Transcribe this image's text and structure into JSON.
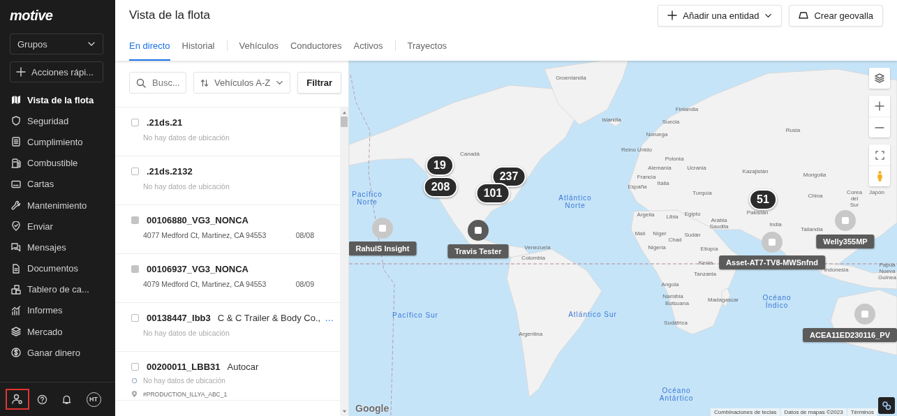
{
  "sidebar": {
    "logo": "motive",
    "groups_dropdown": "Grupos",
    "quick_actions": "Acciones rápi...",
    "nav": [
      {
        "label": "Vista de la flota",
        "selected": true
      },
      {
        "label": "Seguridad",
        "selected": false
      },
      {
        "label": "Cumplimiento",
        "selected": false
      },
      {
        "label": "Combustible",
        "selected": false
      },
      {
        "label": "Cartas",
        "selected": false
      },
      {
        "label": "Mantenimiento",
        "selected": false
      },
      {
        "label": "Enviar",
        "selected": false
      },
      {
        "label": "Mensajes",
        "selected": false
      },
      {
        "label": "Documentos",
        "selected": false
      },
      {
        "label": "Tablero de ca...",
        "selected": false
      },
      {
        "label": "Informes",
        "selected": false
      },
      {
        "label": "Mercado",
        "selected": false
      },
      {
        "label": "Ganar dinero",
        "selected": false
      }
    ],
    "footer": [
      {
        "kind": "user-settings",
        "highlighted": true
      },
      {
        "kind": "help",
        "highlighted": false
      },
      {
        "kind": "notifications",
        "highlighted": false
      },
      {
        "kind": "avatar",
        "initials": "HT",
        "highlighted": false
      }
    ]
  },
  "header": {
    "title": "Vista de la flota",
    "buttons": [
      {
        "kind": "add",
        "label": "Añadir una entidad"
      },
      {
        "kind": "geofence",
        "label": "Crear geovalla"
      }
    ]
  },
  "tabs": [
    {
      "label": "En directo",
      "selected": true,
      "divider_before": false
    },
    {
      "label": "Historial",
      "selected": false,
      "divider_before": false
    },
    {
      "label": "Vehículos",
      "selected": false,
      "divider_before": true
    },
    {
      "label": "Conductores",
      "selected": false,
      "divider_before": false
    },
    {
      "label": "Activos",
      "selected": false,
      "divider_before": false
    },
    {
      "label": "Trayectos",
      "selected": false,
      "divider_before": true
    }
  ],
  "toolbar": {
    "search": {
      "placeholder": "Busc..."
    },
    "sort": "Vehículos A-Z",
    "filter": "Filtrar"
  },
  "vehicles": [
    {
      "kind": "plain",
      "name": ".21ds.21",
      "location": "No hay datos de ubicación",
      "disabled": false
    },
    {
      "kind": "plain",
      "name": ".21ds.2132",
      "location": "No hay datos de ubicación",
      "disabled": false
    },
    {
      "kind": "plain",
      "name": "00106880_VG3_NONCA",
      "location": "4077 Medford Ct, Martinez, CA 94553",
      "date": "08/08",
      "disabled": true
    },
    {
      "kind": "plain",
      "name": "00106937_VG3_NONCA",
      "location": "4079 Medford Ct, Martinez, CA 94553",
      "date": "08/09",
      "disabled": true
    },
    {
      "kind": "plain",
      "name": "00138447_lbb3",
      "group": "C & C Trailer & Body Co.,",
      "more": "…",
      "location": "No hay datos de ubicación",
      "disabled": false
    },
    {
      "kind": "route",
      "name": "00200011_LBB31",
      "group": "Autocar",
      "location": "No hay datos de ubicación",
      "tag": "#PRODUCTION_ILLYA_ABC_1",
      "disabled": false
    }
  ],
  "map": {
    "labels": [
      {
        "text": "Groenlandia",
        "kind": "country"
      },
      {
        "text": "Islandia",
        "kind": "country"
      },
      {
        "text": "Canadá",
        "kind": "country"
      },
      {
        "text": "Pacífico Norte",
        "kind": "ocean"
      },
      {
        "text": "Atlántico Norte",
        "kind": "ocean"
      },
      {
        "text": "Venezuela",
        "kind": "country"
      },
      {
        "text": "Colombia",
        "kind": "country"
      },
      {
        "text": "Finlandia",
        "kind": "country"
      },
      {
        "text": "Suecia",
        "kind": "country"
      },
      {
        "text": "Noruega",
        "kind": "country"
      },
      {
        "text": "Reino Unido",
        "kind": "country"
      },
      {
        "text": "Polonia",
        "kind": "country"
      },
      {
        "text": "Alemania",
        "kind": "country"
      },
      {
        "text": "Ucrania",
        "kind": "country"
      },
      {
        "text": "Francia",
        "kind": "country"
      },
      {
        "text": "Italia",
        "kind": "country"
      },
      {
        "text": "España",
        "kind": "country"
      },
      {
        "text": "Turquía",
        "kind": "country"
      },
      {
        "text": "Rusia",
        "kind": "country"
      },
      {
        "text": "Kazajistán",
        "kind": "country"
      },
      {
        "text": "Mongolia",
        "kind": "country"
      },
      {
        "text": "China",
        "kind": "country"
      },
      {
        "text": "Corea del Sur",
        "kind": "country"
      },
      {
        "text": "Japón",
        "kind": "country"
      },
      {
        "text": "Argelia",
        "kind": "country"
      },
      {
        "text": "Libia",
        "kind": "country"
      },
      {
        "text": "Egipto",
        "kind": "country"
      },
      {
        "text": "Arabia Saudita",
        "kind": "country"
      },
      {
        "text": "Pakistán",
        "kind": "country"
      },
      {
        "text": "India",
        "kind": "country"
      },
      {
        "text": "Tailandia",
        "kind": "country"
      },
      {
        "text": "Malí",
        "kind": "country"
      },
      {
        "text": "Níger",
        "kind": "country"
      },
      {
        "text": "Chad",
        "kind": "country"
      },
      {
        "text": "Sudán",
        "kind": "country"
      },
      {
        "text": "Nigeria",
        "kind": "country"
      },
      {
        "text": "Etiopía",
        "kind": "country"
      },
      {
        "text": "Kenia",
        "kind": "country"
      },
      {
        "text": "Tanzania",
        "kind": "country"
      },
      {
        "text": "Indonesia",
        "kind": "country"
      },
      {
        "text": "Papúa Nueva Guinea",
        "kind": "country"
      },
      {
        "text": "Angola",
        "kind": "country"
      },
      {
        "text": "Namibia",
        "kind": "country"
      },
      {
        "text": "Botsuana",
        "kind": "country"
      },
      {
        "text": "Madagascar",
        "kind": "country"
      },
      {
        "text": "Sudáfrica",
        "kind": "country"
      },
      {
        "text": "Océano Índico",
        "kind": "ocean"
      },
      {
        "text": "Atlántico Sur",
        "kind": "ocean"
      },
      {
        "text": "Pacífico Sur",
        "kind": "ocean"
      },
      {
        "text": "Argentina",
        "kind": "country"
      },
      {
        "text": "Océano Antártico",
        "kind": "ocean"
      }
    ],
    "clusters": [
      "19",
      "208",
      "237",
      "101",
      "51"
    ],
    "assets": [
      {
        "name": "RahulS Insight",
        "color": "#c8c8c8"
      },
      {
        "name": "Travis Tester",
        "color": "#5a5a5a"
      },
      {
        "name": "Asset-AT7-TV8-MWSnfnd",
        "color": "#c8c8c8"
      },
      {
        "name": "Welly355MP",
        "color": "#c8c8c8"
      },
      {
        "name": "ACEA11ED230116_PV",
        "color": "#c8c8c8"
      }
    ],
    "logo": "Google",
    "attribution": [
      "Combinaciones de teclas",
      "Datos de mapas ©2023",
      "Términos"
    ]
  }
}
